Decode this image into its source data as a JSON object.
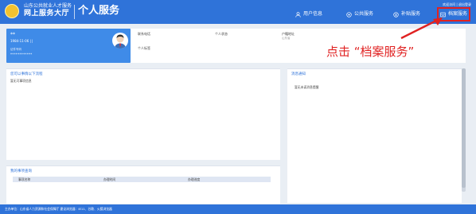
{
  "header": {
    "brand_top": "山东公共就业人才服务",
    "brand_main": "网上服务大厅",
    "brand_sub": "个人服务",
    "top_links": "欢迎访问 | 退出登录",
    "nav": [
      {
        "label": "用户信息",
        "icon": "user-icon"
      },
      {
        "label": "公共服务",
        "icon": "public-service-icon"
      },
      {
        "label": "补贴服务",
        "icon": "subsidy-icon"
      },
      {
        "label": "档案服务",
        "icon": "archive-icon"
      }
    ],
    "colors": {
      "primary": "#2f73d9",
      "card": "#3f8be8",
      "highlight": "#e02222"
    }
  },
  "profile": {
    "name": "**",
    "birth": "1984-11-06 | |",
    "id_label": "证件号码",
    "id_value": "************"
  },
  "info": {
    "contact_phone": "联系电话",
    "personal_status": "个人状态",
    "household": "户籍地址",
    "household_value": "山东省",
    "personal_tags": "个人标签"
  },
  "annotation": "点击 “档案服务”",
  "todo": {
    "title": "您可以事情以下流程",
    "body": "暂无可事项信息"
  },
  "messages": {
    "title": "消息通知",
    "body": "暂无未读消息提醒"
  },
  "my_items": {
    "title": "我的事项查询",
    "columns": [
      "事项名称",
      "办理时间",
      "办理进度"
    ]
  },
  "footer": {
    "text": "主办单位：山东省人力资源和社会保障厅  建议浏览器：IE11、谷歌、火狐浏览器"
  }
}
